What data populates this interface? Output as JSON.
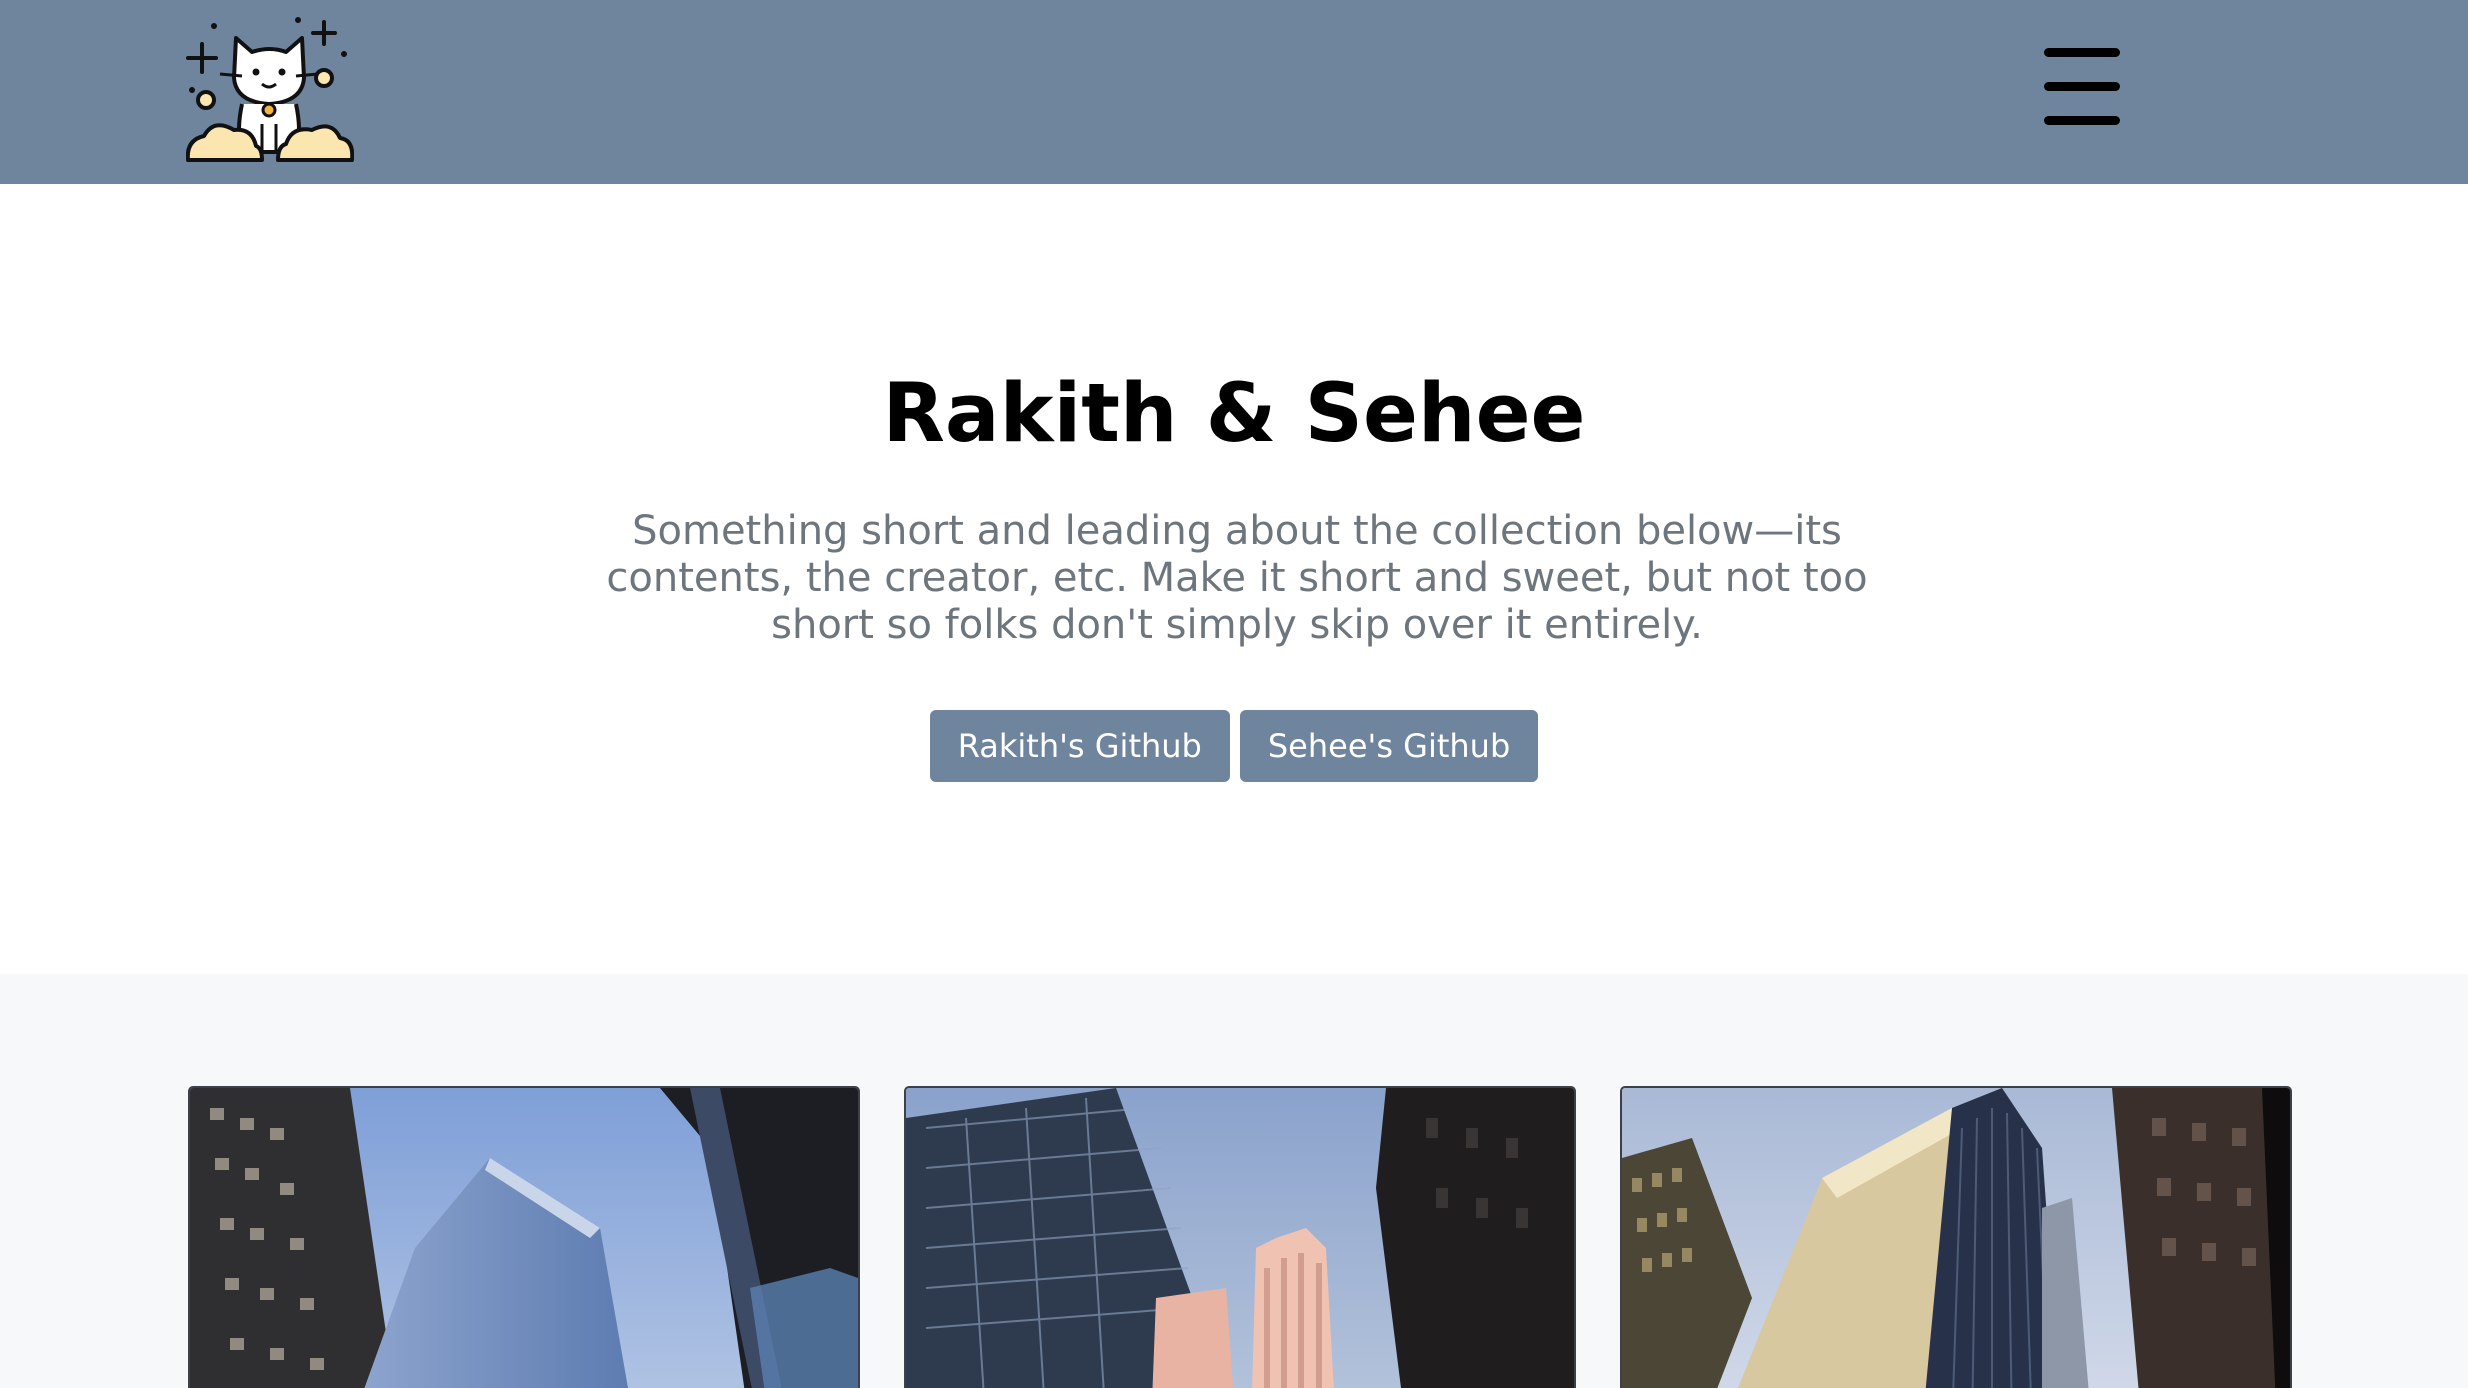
{
  "header": {
    "logo_icon": "cat-on-clouds-logo-icon",
    "menu_icon": "hamburger-menu-icon",
    "background_color": "#6f859e"
  },
  "hero": {
    "title": "Rakith & Sehee",
    "lead": "Something short and leading about the collection below—its contents, the creator, etc. Make it short and sweet, but not too short so folks don't simply skip over it entirely.",
    "buttons": [
      {
        "label": "Rakith's Github"
      },
      {
        "label": "Sehee's Github"
      }
    ]
  },
  "album": {
    "cards": [
      {
        "image": "skyscrapers-photo-1"
      },
      {
        "image": "skyscrapers-photo-2"
      },
      {
        "image": "skyscrapers-photo-3"
      }
    ]
  }
}
